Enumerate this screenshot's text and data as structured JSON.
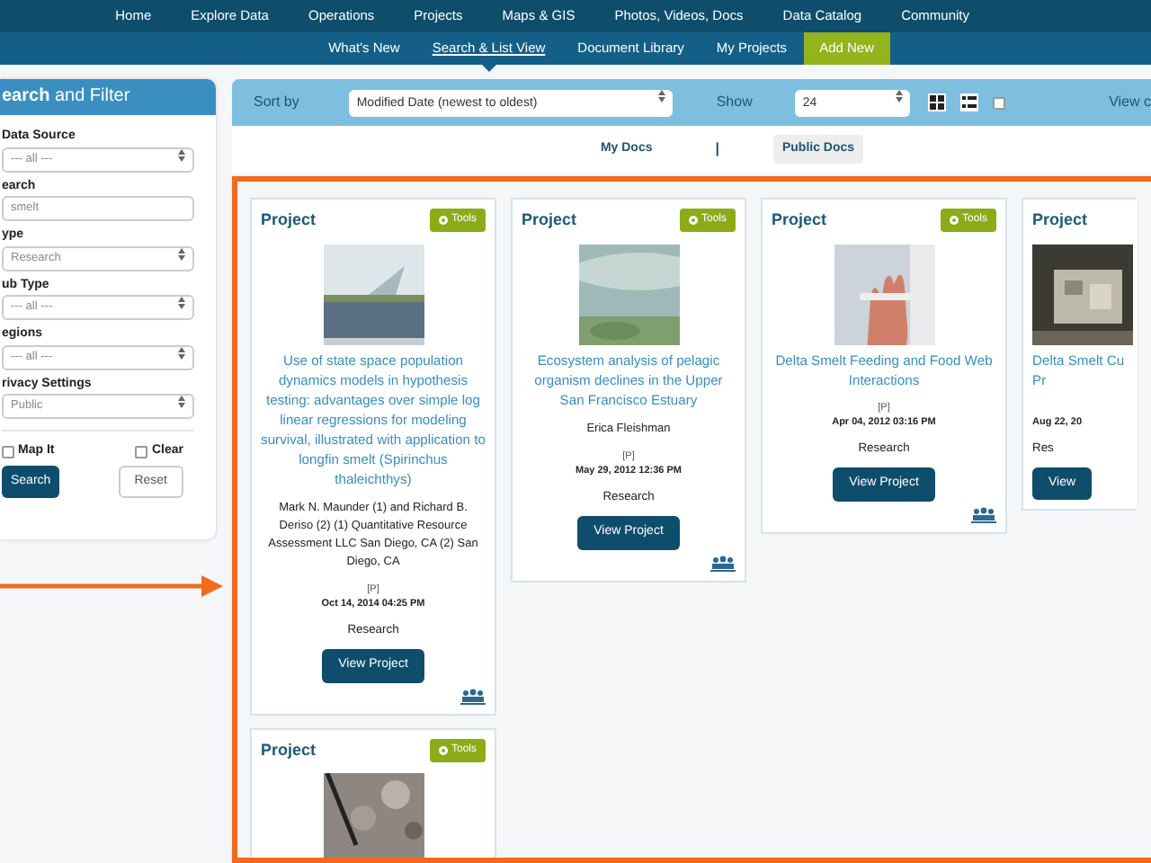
{
  "top_nav": [
    {
      "label": "Home"
    },
    {
      "label": "Explore Data"
    },
    {
      "label": "Operations"
    },
    {
      "label": "Projects"
    },
    {
      "label": "Maps & GIS"
    },
    {
      "label": "Photos, Videos, Docs"
    },
    {
      "label": "Data Catalog"
    },
    {
      "label": "Community"
    }
  ],
  "sub_nav": [
    {
      "label": "What's New",
      "selected": false,
      "kind": "link"
    },
    {
      "label": "Search & List View",
      "selected": true,
      "kind": "link"
    },
    {
      "label": "Document Library",
      "selected": false,
      "kind": "link"
    },
    {
      "label": "My Projects",
      "selected": false,
      "kind": "link"
    },
    {
      "label": "Add New",
      "selected": false,
      "kind": "action"
    }
  ],
  "sidebar": {
    "title": "**earch** and Filter",
    "fields": [
      {
        "label": "Data Source",
        "kind": "select",
        "value": "--- all ---"
      },
      {
        "label": "earch",
        "kind": "text",
        "value": "smelt"
      },
      {
        "label": "ype",
        "kind": "select",
        "value": "Research"
      },
      {
        "label": "ub Type",
        "kind": "select",
        "value": "--- all ---"
      },
      {
        "label": "egions",
        "kind": "select",
        "value": "--- all ---"
      },
      {
        "label": "rivacy Settings",
        "kind": "select",
        "value": "Public"
      }
    ],
    "checkboxes": [
      {
        "label": "Map It",
        "checked": false
      },
      {
        "label": "Clear",
        "checked": false
      }
    ],
    "search_button": "Search",
    "reset_button": "Reset"
  },
  "toolbar": {
    "sort_label": "Sort by",
    "sort_value": "Modified Date (newest to oldest)",
    "show_label": "Show",
    "show_value": "24",
    "view_checked": false,
    "view_label": "View c"
  },
  "doc_tabs": [
    {
      "label": "My Docs",
      "selected": false
    },
    {
      "label": "Public Docs",
      "selected": true
    }
  ],
  "doc_tab_separator": "|",
  "cards": [
    {
      "header": "Project",
      "tools": "Tools",
      "title": "Use of state space population dynamics models in hypothesis testing: advantages over simple log linear regressions for modeling survival, illustrated with application to longfin smelt (Spirinchus thaleichthys)",
      "authors": "Mark N. Maunder (1) and Richard B. Deriso (2) (1) Quantitative Resource Assessment LLC San Diego, CA (2) San Diego, CA",
      "privacy": "[P]",
      "date": "Oct 14, 2014 04:25 PM",
      "type": "Research",
      "button": "View Project",
      "partial": false
    },
    {
      "header": "Project",
      "tools": "Tools",
      "title": "Ecosystem analysis of pelagic organism declines in the Upper San Francisco Estuary",
      "authors": "Erica Fleishman",
      "privacy": "[P]",
      "date": "May 29, 2012 12:36 PM",
      "type": "Research",
      "button": "View Project",
      "partial": false
    },
    {
      "header": "Project",
      "tools": "Tools",
      "title": "Delta Smelt Feeding and Food Web Interactions",
      "privacy": "[P]",
      "date": "Apr 04, 2012 03:16 PM",
      "type": "Research",
      "button": "View Project",
      "partial": false
    },
    {
      "header": "Project",
      "title": "Delta Smelt Cu Pr",
      "date": "Aug 22, 20",
      "type": "Res",
      "button": "View",
      "partial": true
    },
    {
      "header": "Project",
      "tools": "Tools",
      "partial": false
    }
  ]
}
